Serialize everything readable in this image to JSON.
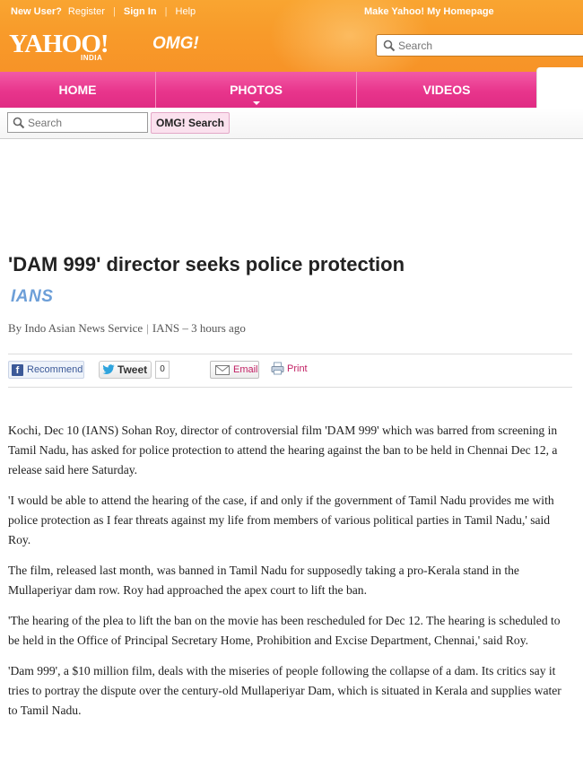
{
  "header": {
    "new_user_label": "New User?",
    "register_label": "Register",
    "sign_in_label": "Sign In",
    "help_label": "Help",
    "make_homepage_label": "Make Yahoo! My Homepage",
    "logo_text": "YAHOO!",
    "logo_region": "INDIA",
    "logo_product": "OMG!",
    "search_placeholder": "Search"
  },
  "nav": {
    "tabs": [
      {
        "label": "HOME"
      },
      {
        "label": "PHOTOS"
      },
      {
        "label": "VIDEOS"
      }
    ]
  },
  "subsearch": {
    "placeholder": "Search",
    "button_label": "OMG! Search"
  },
  "article": {
    "headline": "'DAM 999' director seeks police protection",
    "source_logo": "IANS",
    "byline_author": "By Indo Asian News Service",
    "byline_source": "IANS",
    "byline_time": "– 3 hours ago",
    "share": {
      "recommend_label": "Recommend",
      "tweet_label": "Tweet",
      "tweet_count": "0",
      "email_label": "Email",
      "print_label": "Print"
    },
    "paragraphs": [
      "Kochi, Dec 10 (IANS) Sohan Roy, director of controversial film 'DAM 999' which was barred from screening in Tamil Nadu, has asked for police protection to attend the hearing against the ban to be held in Chennai Dec 12, a release said here Saturday.",
      "'I would be able to attend the hearing of the case, if and only if the government of Tamil Nadu provides me with police protection as I fear threats against my life from members of various political parties in Tamil Nadu,' said Roy.",
      "The film, released last month, was banned in Tamil Nadu for supposedly taking a pro-Kerala stand in the Mullaperiyar dam row. Roy had approached the apex court to lift the ban.",
      "'The hearing of the plea to lift the ban on the movie has been rescheduled for Dec 12. The hearing is scheduled to be held in the Office of Principal Secretary Home, Prohibition and Excise Department, Chennai,' said Roy.",
      "'Dam 999', a $10 million film, deals with the miseries of people following the collapse of a dam. Its critics say it tries to portray the dispute over the century-old Mullaperiyar Dam, which is situated in Kerala and supplies water to Tamil Nadu."
    ]
  },
  "colors": {
    "header_orange": "#f89b2a",
    "nav_pink": "#e8358c",
    "link_magenta": "#c21f63",
    "source_blue": "#6d9fd8"
  },
  "icons": [
    "search-icon",
    "facebook-icon",
    "twitter-bird-icon",
    "envelope-icon",
    "printer-icon",
    "chevron-down-icon"
  ]
}
